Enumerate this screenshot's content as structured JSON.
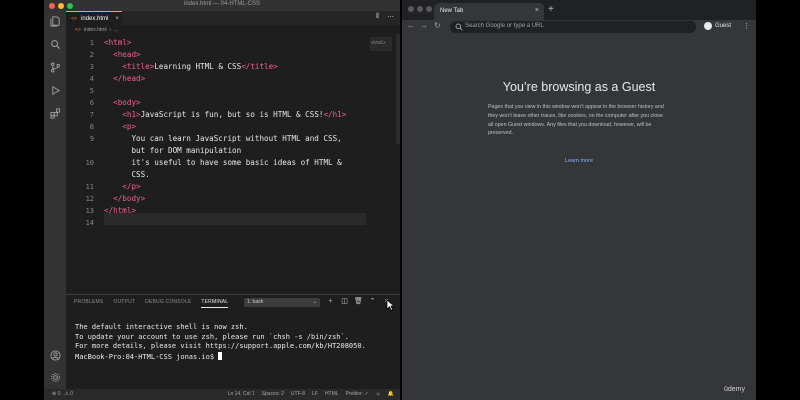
{
  "vscode": {
    "window_title": "index.html — 04-HTML-CSS",
    "tab": {
      "lang": "<>",
      "name": "index.html",
      "close": "×"
    },
    "breadcrumb": {
      "file_icon": "<>",
      "file": "index.html",
      "sep": "›",
      "more": "..."
    },
    "tabbar_actions": [
      "⫴",
      "⋯"
    ],
    "minimap_label": "<html>",
    "lines": [
      {
        "n": "1",
        "html": "<span class='t'>&lt;html&gt;</span>"
      },
      {
        "n": "2",
        "html": "  <span class='t'>&lt;head&gt;</span>"
      },
      {
        "n": "3",
        "html": "    <span class='t'>&lt;title&gt;</span><span class='txt'>Learning HTML &amp; CSS</span><span class='t'>&lt;/title&gt;</span>"
      },
      {
        "n": "4",
        "html": "  <span class='t'>&lt;/head&gt;</span>"
      },
      {
        "n": "5",
        "html": ""
      },
      {
        "n": "6",
        "html": "  <span class='t'>&lt;body&gt;</span>"
      },
      {
        "n": "7",
        "html": "    <span class='t'>&lt;h1&gt;</span><span class='txt'>JavaScript is fun, but so is HTML &amp; CSS!</span><span class='t'>&lt;/h1&gt;</span>"
      },
      {
        "n": "8",
        "html": "    <span class='t'>&lt;p&gt;</span>"
      },
      {
        "n": "9",
        "html": "      <span class='txt'>You can learn JavaScript without HTML and CSS,</span>"
      },
      {
        "n": "",
        "html": "      <span class='txt'>but for DOM manipulation</span>"
      },
      {
        "n": "10",
        "html": "      <span class='txt'>it's useful to have some basic ideas of HTML &amp;</span>"
      },
      {
        "n": "",
        "html": "      <span class='txt'>CSS.</span>"
      },
      {
        "n": "11",
        "html": "    <span class='t'>&lt;/p&gt;</span>"
      },
      {
        "n": "12",
        "html": "  <span class='t'>&lt;/body&gt;</span>"
      },
      {
        "n": "13",
        "html": "<span class='t'>&lt;/html&gt;</span>"
      },
      {
        "n": "14",
        "html": ""
      }
    ],
    "panel_tabs": [
      "PROBLEMS",
      "OUTPUT",
      "DEBUG CONSOLE",
      "TERMINAL"
    ],
    "terminal_select": "1: bash",
    "terminal_select_chevron": "⌄",
    "panel_actions": [
      "+",
      "◫",
      "🗑",
      "⌃",
      "×"
    ],
    "terminal_lines": [
      "The default interactive shell is now zsh.",
      "To update your account to use zsh, please run `chsh -s /bin/zsh`.",
      "For more details, please visit https://support.apple.com/kb/HT208050.",
      "MacBook-Pro:04-HTML-CSS jonas.io$ "
    ],
    "status_left": [
      "⊗ 0",
      "⚠ 0"
    ],
    "status_right": [
      "Ln 14, Col 1",
      "Spaces: 2",
      "UTF-8",
      "LF",
      "HTML",
      "Prettier: ✓",
      "☺",
      "🔔"
    ]
  },
  "chrome": {
    "tab_title": "New Tab",
    "tab_close": "×",
    "new_tab": "+",
    "nav": {
      "back": "←",
      "forward": "→",
      "reload": "↻"
    },
    "omnibox_placeholder": "Search Google or type a URL",
    "profile_label": "Guest",
    "menu": "⋮",
    "guest_title": "You’re browsing as a Guest",
    "guest_desc": "Pages that you view in this window won’t appear in the browser history and they won’t leave other traces, like cookies, on the computer after you close all open Guest windows. Any files that you download, however, will be preserved.",
    "learn_more": "Learn more"
  },
  "watermark": "ūdemy",
  "colors": {
    "tag": "#f06092",
    "traffic_red": "#ff5f57",
    "traffic_yellow": "#febc2e",
    "traffic_green": "#28c840",
    "link": "#8ab4f8"
  }
}
